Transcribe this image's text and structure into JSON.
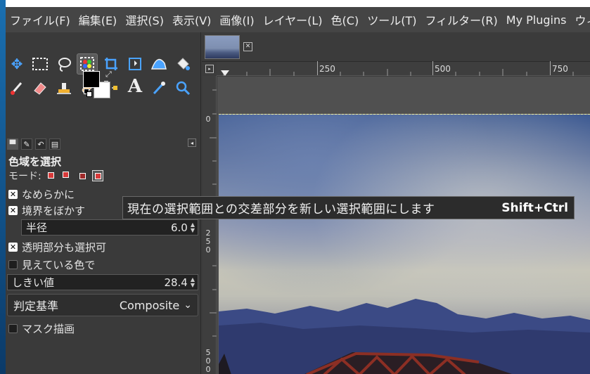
{
  "menubar": {
    "items": [
      "ファイル(F)",
      "編集(E)",
      "選択(S)",
      "表示(V)",
      "画像(I)",
      "レイヤー(L)",
      "色(C)",
      "ツール(T)",
      "フィルター(R)",
      "My Plugins",
      "ウィンドウ(W)"
    ]
  },
  "tool_options": {
    "title": "色域を選択",
    "mode_label": "モード:",
    "antialias_label": "なめらかに",
    "feather_label": "境界をぼかす",
    "radius_label": "半径",
    "radius_value": "6.0",
    "select_transparent_label": "透明部分も選択可",
    "sample_merged_label": "見えている色で",
    "threshold_label": "しきい値",
    "threshold_value": "28.4",
    "criterion_label": "判定基準",
    "criterion_value": "Composite",
    "draw_mask_label": "マスク描画"
  },
  "tooltip": {
    "message": "現在の選択範囲との交差部分を新しい選択範囲にします",
    "shortcut": "Shift+Ctrl"
  },
  "rulers": {
    "top": [
      "250",
      "500",
      "750"
    ],
    "left": [
      "0",
      "2",
      "5",
      "0",
      "5",
      "0",
      "0"
    ]
  },
  "colors": {
    "foreground": "#000000",
    "background": "#ffffff",
    "mode_active": "#d83a3a"
  }
}
